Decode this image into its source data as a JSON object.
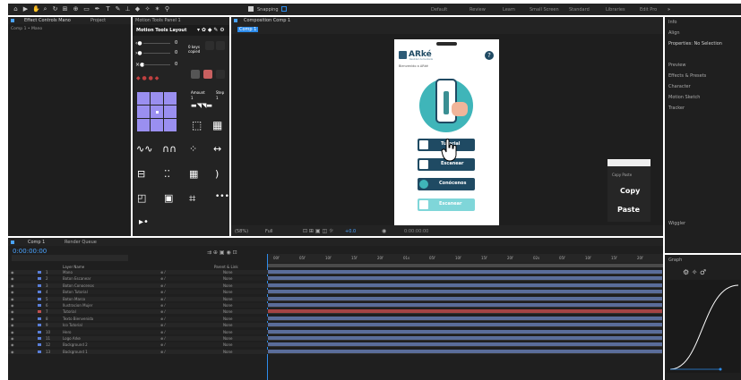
{
  "toolbar": {
    "snapping": "Snapping",
    "workspaces": [
      "Default",
      "Review",
      "Learn",
      "Small Screen",
      "Standard",
      "Libraries",
      "Edit Pro"
    ]
  },
  "left_panel": {
    "tab_effect_controls": "Effect Controls Mano",
    "tab_project": "Project",
    "sub_label": "Comp 1 • Mano"
  },
  "motion_tools": {
    "tab": "Motion Tools Panel 1",
    "title": "Motion Tools Layout",
    "value_zero_a": "0",
    "value_zero_b": "0",
    "value_zero_c": "0",
    "keys_copied": "0 keys copied",
    "amount_label": "Amount",
    "step_label": "Step",
    "amount_value": "1",
    "step_value": "1"
  },
  "composition": {
    "tab": "Composition Comp 1",
    "subtab": "Comp 1",
    "zoom": "(58%)",
    "quality": "Full",
    "exposure": "+0.0",
    "timecode": "0:00:00:00"
  },
  "phone_app": {
    "brand": "ARké",
    "brand_sub": "Realidad Aumentada",
    "welcome": "Bienvenido a ARké",
    "buttons": [
      "Tutorial",
      "Escanear",
      "Conócenos",
      "Escanear"
    ]
  },
  "right_panel": {
    "items": [
      "Info",
      "Align",
      "Properties: No Selection",
      "Preview",
      "Effects & Presets",
      "Character",
      "Motion Sketch",
      "Tracker"
    ],
    "wiggler": "Wiggler",
    "graph": "Graph"
  },
  "copy_paste": {
    "title": "Copy Paste",
    "copy": "Copy",
    "paste": "Paste"
  },
  "timeline": {
    "tab_comp": "Comp 1",
    "tab_render": "Render Queue",
    "timecode": "0:00:00:00",
    "col_source": "Layer Name",
    "col_parent": "Parent & Link",
    "ruler": [
      "00f",
      "05f",
      "10f",
      "15f",
      "20f",
      "01s",
      "05f",
      "10f",
      "15f",
      "20f",
      "02s",
      "05f",
      "10f",
      "15f",
      "20f"
    ],
    "layers": [
      {
        "num": "1",
        "name": "Mano",
        "parent": "None",
        "color": "#5a7fd9"
      },
      {
        "num": "2",
        "name": "Boton Escanear",
        "parent": "None",
        "color": "#5a7fd9"
      },
      {
        "num": "3",
        "name": "Boton Conocenos",
        "parent": "None",
        "color": "#5a7fd9"
      },
      {
        "num": "4",
        "name": "Boton Tutorial",
        "parent": "None",
        "color": "#5a7fd9"
      },
      {
        "num": "5",
        "name": "Boton Marco",
        "parent": "None",
        "color": "#5a7fd9"
      },
      {
        "num": "6",
        "name": "Ilustracion Mujer",
        "parent": "None",
        "color": "#5a7fd9"
      },
      {
        "num": "7",
        "name": "Tutorial",
        "parent": "None",
        "color": "#c05050"
      },
      {
        "num": "8",
        "name": "Texto Bienvenida",
        "parent": "None",
        "color": "#5a7fd9"
      },
      {
        "num": "9",
        "name": "Ico Tutorial",
        "parent": "None",
        "color": "#5a7fd9"
      },
      {
        "num": "10",
        "name": "Hero",
        "parent": "None",
        "color": "#5a7fd9"
      },
      {
        "num": "11",
        "name": "Logo Arke",
        "parent": "None",
        "color": "#5a7fd9"
      },
      {
        "num": "12",
        "name": "Background 2",
        "parent": "None",
        "color": "#5a7fd9"
      },
      {
        "num": "13",
        "name": "Background 1",
        "parent": "None",
        "color": "#5a7fd9"
      }
    ]
  },
  "colors": {
    "accent_blue": "#2d8ceb",
    "purple": "#9a8ff0",
    "app_dark": "#1f4a63",
    "app_teal": "#3fb5b9",
    "timecode": "#4aa3ff"
  }
}
